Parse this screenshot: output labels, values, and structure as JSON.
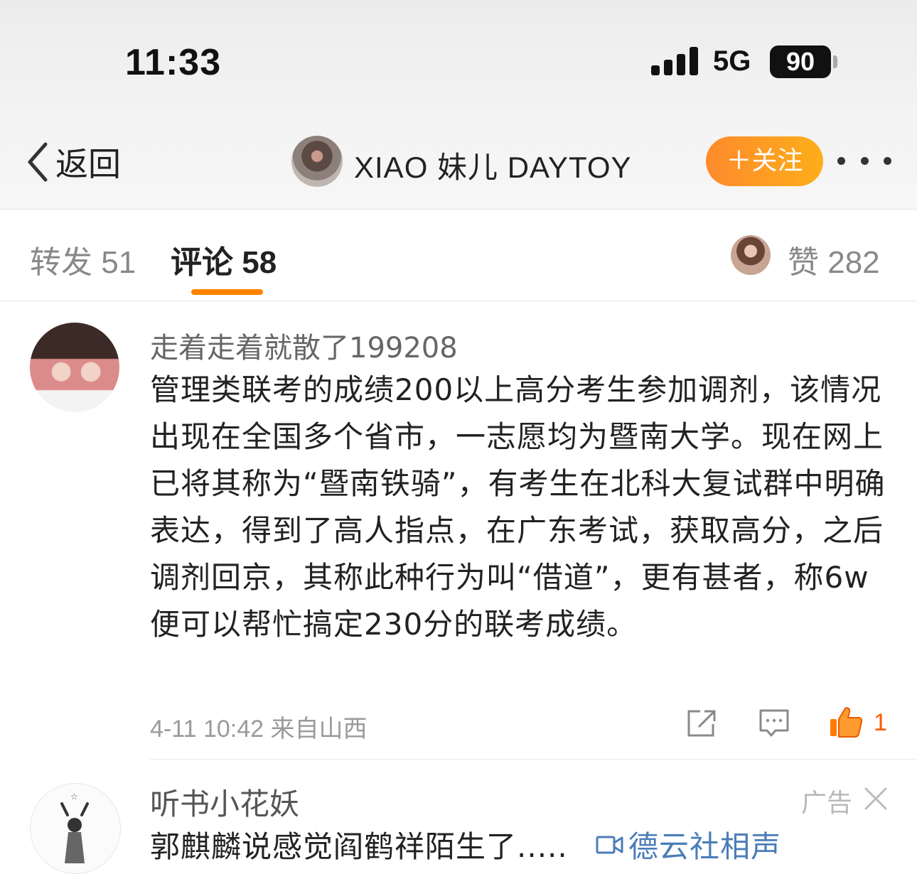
{
  "status_bar": {
    "time": "11:33",
    "network": "5G",
    "battery": "90"
  },
  "nav": {
    "back_label": "返回",
    "title": "XIAO 妹儿 DAYTOY",
    "follow_label": "＋关注"
  },
  "tabs": {
    "repost": "转发 51",
    "comment": "评论 58",
    "likes": "赞 282"
  },
  "comment": {
    "author": "走着走着就散了199208",
    "text": "管理类联考的成绩200以上高分考生参加调剂，该情况出现在全国多个省市，一志愿均为暨南大学。现在网上已将其称为“暨南铁骑”，有考生在北科大复试群中明确表达，得到了高人指点，在广东考试，获取高分，之后调剂回京，其称此种行为叫“借道”，更有甚者，称6w便可以帮忙搞定230分的联考成绩。",
    "meta": "4-11 10:42  来自山西",
    "like_count": "1"
  },
  "ad": {
    "author": "听书小花妖",
    "tag": "广告",
    "text": "郭麒麟说感觉阎鹤祥陌生了.....",
    "link_text": "德云社相声"
  },
  "colors": {
    "accent": "#ff8200",
    "follow_start": "#fe8a2c",
    "follow_end": "#fdae1a",
    "link": "#4a7db8"
  }
}
